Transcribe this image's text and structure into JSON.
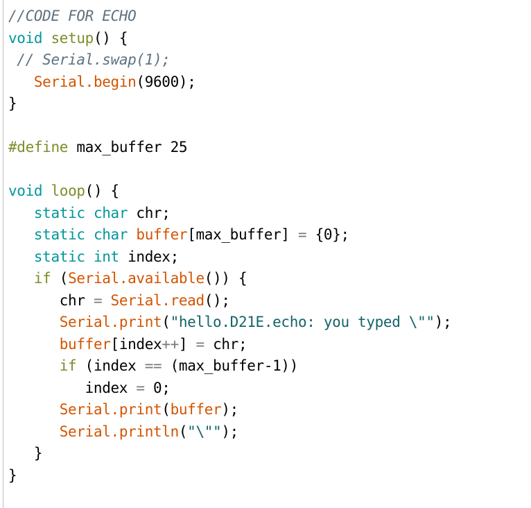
{
  "editor": {
    "name": "arduino-code-editor",
    "background_color": "#ffffff",
    "gutter_color": "#bdbdbd",
    "font_size_px": 21,
    "line_height_px": 31.5,
    "palette": {
      "plain": "#000000",
      "comment": "#5e7180",
      "keyword": "#00979c",
      "function": "#7e8c2b",
      "preprocessor": "#7e8c2b",
      "identifier": "#d35400",
      "string": "#136368",
      "operator": "#787878"
    }
  },
  "code": {
    "language": "arduino-c",
    "line_count": 22,
    "plain_text": "//CODE FOR ECHO\nvoid setup() {\n // Serial.swap(1);\n   Serial.begin(9600);\n}\n\n#define max_buffer 25\n\nvoid loop() {\n   static char chr;\n   static char buffer[max_buffer] = {0};\n   static int index;\n   if (Serial.available()) {\n      chr = Serial.read();\n      Serial.print(\"hello.D21E.echo: you typed \\\"\");\n      buffer[index++] = chr;\n      if (index == (max_buffer-1))\n         index = 0;\n      Serial.print(buffer);\n      Serial.println(\"\\\"\");\n   }\n}",
    "lines": [
      {
        "n": 1,
        "tokens": [
          {
            "t": "comment",
            "v": "//CODE FOR ECHO"
          }
        ]
      },
      {
        "n": 2,
        "tokens": [
          {
            "t": "keyword",
            "v": "void"
          },
          {
            "t": "plain",
            "v": " "
          },
          {
            "t": "func",
            "v": "setup"
          },
          {
            "t": "brace",
            "v": "() {"
          }
        ]
      },
      {
        "n": 3,
        "tokens": [
          {
            "t": "plain",
            "v": " "
          },
          {
            "t": "comment",
            "v": "// Serial.swap(1);"
          }
        ]
      },
      {
        "n": 4,
        "tokens": [
          {
            "t": "plain",
            "v": "   "
          },
          {
            "t": "ident",
            "v": "Serial.begin"
          },
          {
            "t": "brace",
            "v": "("
          },
          {
            "t": "number",
            "v": "9600"
          },
          {
            "t": "brace",
            "v": ");"
          }
        ]
      },
      {
        "n": 5,
        "tokens": [
          {
            "t": "brace",
            "v": "}"
          }
        ]
      },
      {
        "n": 6,
        "tokens": [
          {
            "t": "plain",
            "v": ""
          }
        ]
      },
      {
        "n": 7,
        "tokens": [
          {
            "t": "pre",
            "v": "#define"
          },
          {
            "t": "plain",
            "v": " max_buffer "
          },
          {
            "t": "number",
            "v": "25"
          }
        ]
      },
      {
        "n": 8,
        "tokens": [
          {
            "t": "plain",
            "v": ""
          }
        ]
      },
      {
        "n": 9,
        "tokens": [
          {
            "t": "keyword",
            "v": "void"
          },
          {
            "t": "plain",
            "v": " "
          },
          {
            "t": "func",
            "v": "loop"
          },
          {
            "t": "brace",
            "v": "() {"
          }
        ]
      },
      {
        "n": 10,
        "tokens": [
          {
            "t": "plain",
            "v": "   "
          },
          {
            "t": "keyword",
            "v": "static char"
          },
          {
            "t": "plain",
            "v": " chr;"
          }
        ]
      },
      {
        "n": 11,
        "tokens": [
          {
            "t": "plain",
            "v": "   "
          },
          {
            "t": "keyword",
            "v": "static char"
          },
          {
            "t": "plain",
            "v": " "
          },
          {
            "t": "ident",
            "v": "buffer"
          },
          {
            "t": "plain",
            "v": "[max_buffer] "
          },
          {
            "t": "op",
            "v": "="
          },
          {
            "t": "plain",
            "v": " {"
          },
          {
            "t": "number",
            "v": "0"
          },
          {
            "t": "plain",
            "v": "};"
          }
        ]
      },
      {
        "n": 12,
        "tokens": [
          {
            "t": "plain",
            "v": "   "
          },
          {
            "t": "keyword",
            "v": "static int"
          },
          {
            "t": "plain",
            "v": " index;"
          }
        ]
      },
      {
        "n": 13,
        "tokens": [
          {
            "t": "plain",
            "v": "   "
          },
          {
            "t": "pre",
            "v": "if"
          },
          {
            "t": "plain",
            "v": " ("
          },
          {
            "t": "ident",
            "v": "Serial.available"
          },
          {
            "t": "brace",
            "v": "()) {"
          }
        ]
      },
      {
        "n": 14,
        "tokens": [
          {
            "t": "plain",
            "v": "      chr "
          },
          {
            "t": "op",
            "v": "="
          },
          {
            "t": "plain",
            "v": " "
          },
          {
            "t": "ident",
            "v": "Serial.read"
          },
          {
            "t": "brace",
            "v": "();"
          }
        ]
      },
      {
        "n": 15,
        "tokens": [
          {
            "t": "plain",
            "v": "      "
          },
          {
            "t": "ident",
            "v": "Serial.print"
          },
          {
            "t": "brace",
            "v": "("
          },
          {
            "t": "string",
            "v": "\"hello.D21E.echo: you typed \\\"\""
          },
          {
            "t": "brace",
            "v": ");"
          }
        ]
      },
      {
        "n": 16,
        "tokens": [
          {
            "t": "plain",
            "v": "      "
          },
          {
            "t": "ident",
            "v": "buffer"
          },
          {
            "t": "plain",
            "v": "[index"
          },
          {
            "t": "op",
            "v": "++"
          },
          {
            "t": "plain",
            "v": "] "
          },
          {
            "t": "op",
            "v": "="
          },
          {
            "t": "plain",
            "v": " chr;"
          }
        ]
      },
      {
        "n": 17,
        "tokens": [
          {
            "t": "plain",
            "v": "      "
          },
          {
            "t": "pre",
            "v": "if"
          },
          {
            "t": "plain",
            "v": " (index "
          },
          {
            "t": "op",
            "v": "=="
          },
          {
            "t": "plain",
            "v": " (max_buffer-"
          },
          {
            "t": "number",
            "v": "1"
          },
          {
            "t": "plain",
            "v": "))"
          }
        ]
      },
      {
        "n": 18,
        "tokens": [
          {
            "t": "plain",
            "v": "         index "
          },
          {
            "t": "op",
            "v": "="
          },
          {
            "t": "plain",
            "v": " "
          },
          {
            "t": "number",
            "v": "0"
          },
          {
            "t": "plain",
            "v": ";"
          }
        ]
      },
      {
        "n": 19,
        "tokens": [
          {
            "t": "plain",
            "v": "      "
          },
          {
            "t": "ident",
            "v": "Serial.print"
          },
          {
            "t": "brace",
            "v": "("
          },
          {
            "t": "ident",
            "v": "buffer"
          },
          {
            "t": "brace",
            "v": ");"
          }
        ]
      },
      {
        "n": 20,
        "tokens": [
          {
            "t": "plain",
            "v": "      "
          },
          {
            "t": "ident",
            "v": "Serial.println"
          },
          {
            "t": "brace",
            "v": "("
          },
          {
            "t": "string",
            "v": "\"\\\"\""
          },
          {
            "t": "brace",
            "v": ");"
          }
        ]
      },
      {
        "n": 21,
        "tokens": [
          {
            "t": "plain",
            "v": "   "
          },
          {
            "t": "brace",
            "v": "}"
          }
        ]
      },
      {
        "n": 22,
        "tokens": [
          {
            "t": "brace",
            "v": "}"
          }
        ]
      }
    ]
  }
}
